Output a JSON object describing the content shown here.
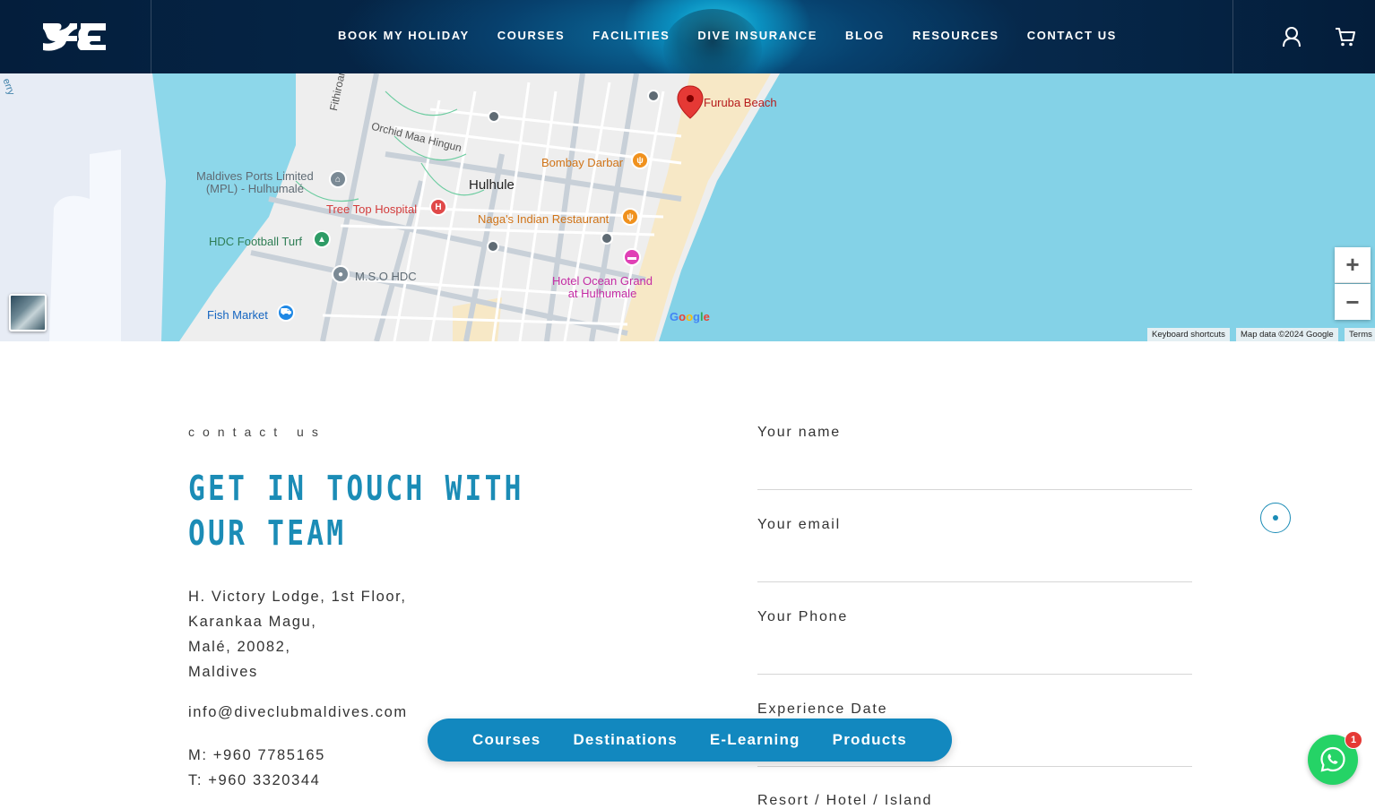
{
  "header": {
    "logo_icon": "dive-club-logo",
    "nav": [
      {
        "label": "BOOK MY HOLIDAY"
      },
      {
        "label": "COURSES"
      },
      {
        "label": "FACILITIES"
      },
      {
        "label": "DIVE INSURANCE"
      },
      {
        "label": "BLOG"
      },
      {
        "label": "RESOURCES"
      },
      {
        "label": "CONTACT US"
      }
    ],
    "account_icon": "user-icon",
    "cart_icon": "cart-icon"
  },
  "map": {
    "marker_label": "Furuba Beach",
    "area_label": "Hulhule",
    "road_labels": [
      "Fithiroanu Magu",
      "Orchid Maa Hingun"
    ],
    "pois": {
      "ports": "Maldives Ports Limited\n(MPL) - Hulhumalé",
      "hospital": "Tree Top Hospital",
      "football": "HDC Football Turf",
      "mso": "M.S.O HDC",
      "fish": "Fish Market",
      "bombay": "Bombay Darbar",
      "naga": "Naga's Indian Restaurant",
      "hotel": "Hotel Ocean Grand\nat Hulhumale"
    },
    "edge_label": "erry",
    "zoom_in": "+",
    "zoom_out": "−",
    "google": "Google",
    "attribution": {
      "shortcuts": "Keyboard shortcuts",
      "data": "Map data ©2024 Google",
      "terms": "Terms"
    },
    "colors": {
      "water": "#8dd7ea",
      "land": "#eeeeee",
      "marker": "#e53935"
    }
  },
  "contact": {
    "eyebrow": "contact us",
    "headline": "GET IN TOUCH WITH OUR TEAM",
    "address": [
      "H. Victory Lodge, 1st Floor,",
      "Karankaa Magu,",
      "Malé, 20082,",
      "Maldives"
    ],
    "email": "info@diveclubmaldives.com",
    "mobile": "M: +960 7785165",
    "telephone": "T: +960 3320344"
  },
  "form": {
    "name_label": "Your name",
    "email_label": "Your email",
    "phone_label": "Your Phone",
    "date_label": "Experience Date",
    "resort_label": "Resort / Hotel / Island"
  },
  "quick_nav": [
    {
      "label": "Courses"
    },
    {
      "label": "Destinations"
    },
    {
      "label": "E-Learning"
    },
    {
      "label": "Products"
    }
  ],
  "whatsapp": {
    "icon": "whatsapp-icon",
    "badge": "1"
  },
  "colors": {
    "accent": "#1b8cb6",
    "pill": "#1288bf",
    "whatsapp": "#25d366",
    "header_dark": "#041e3c"
  }
}
